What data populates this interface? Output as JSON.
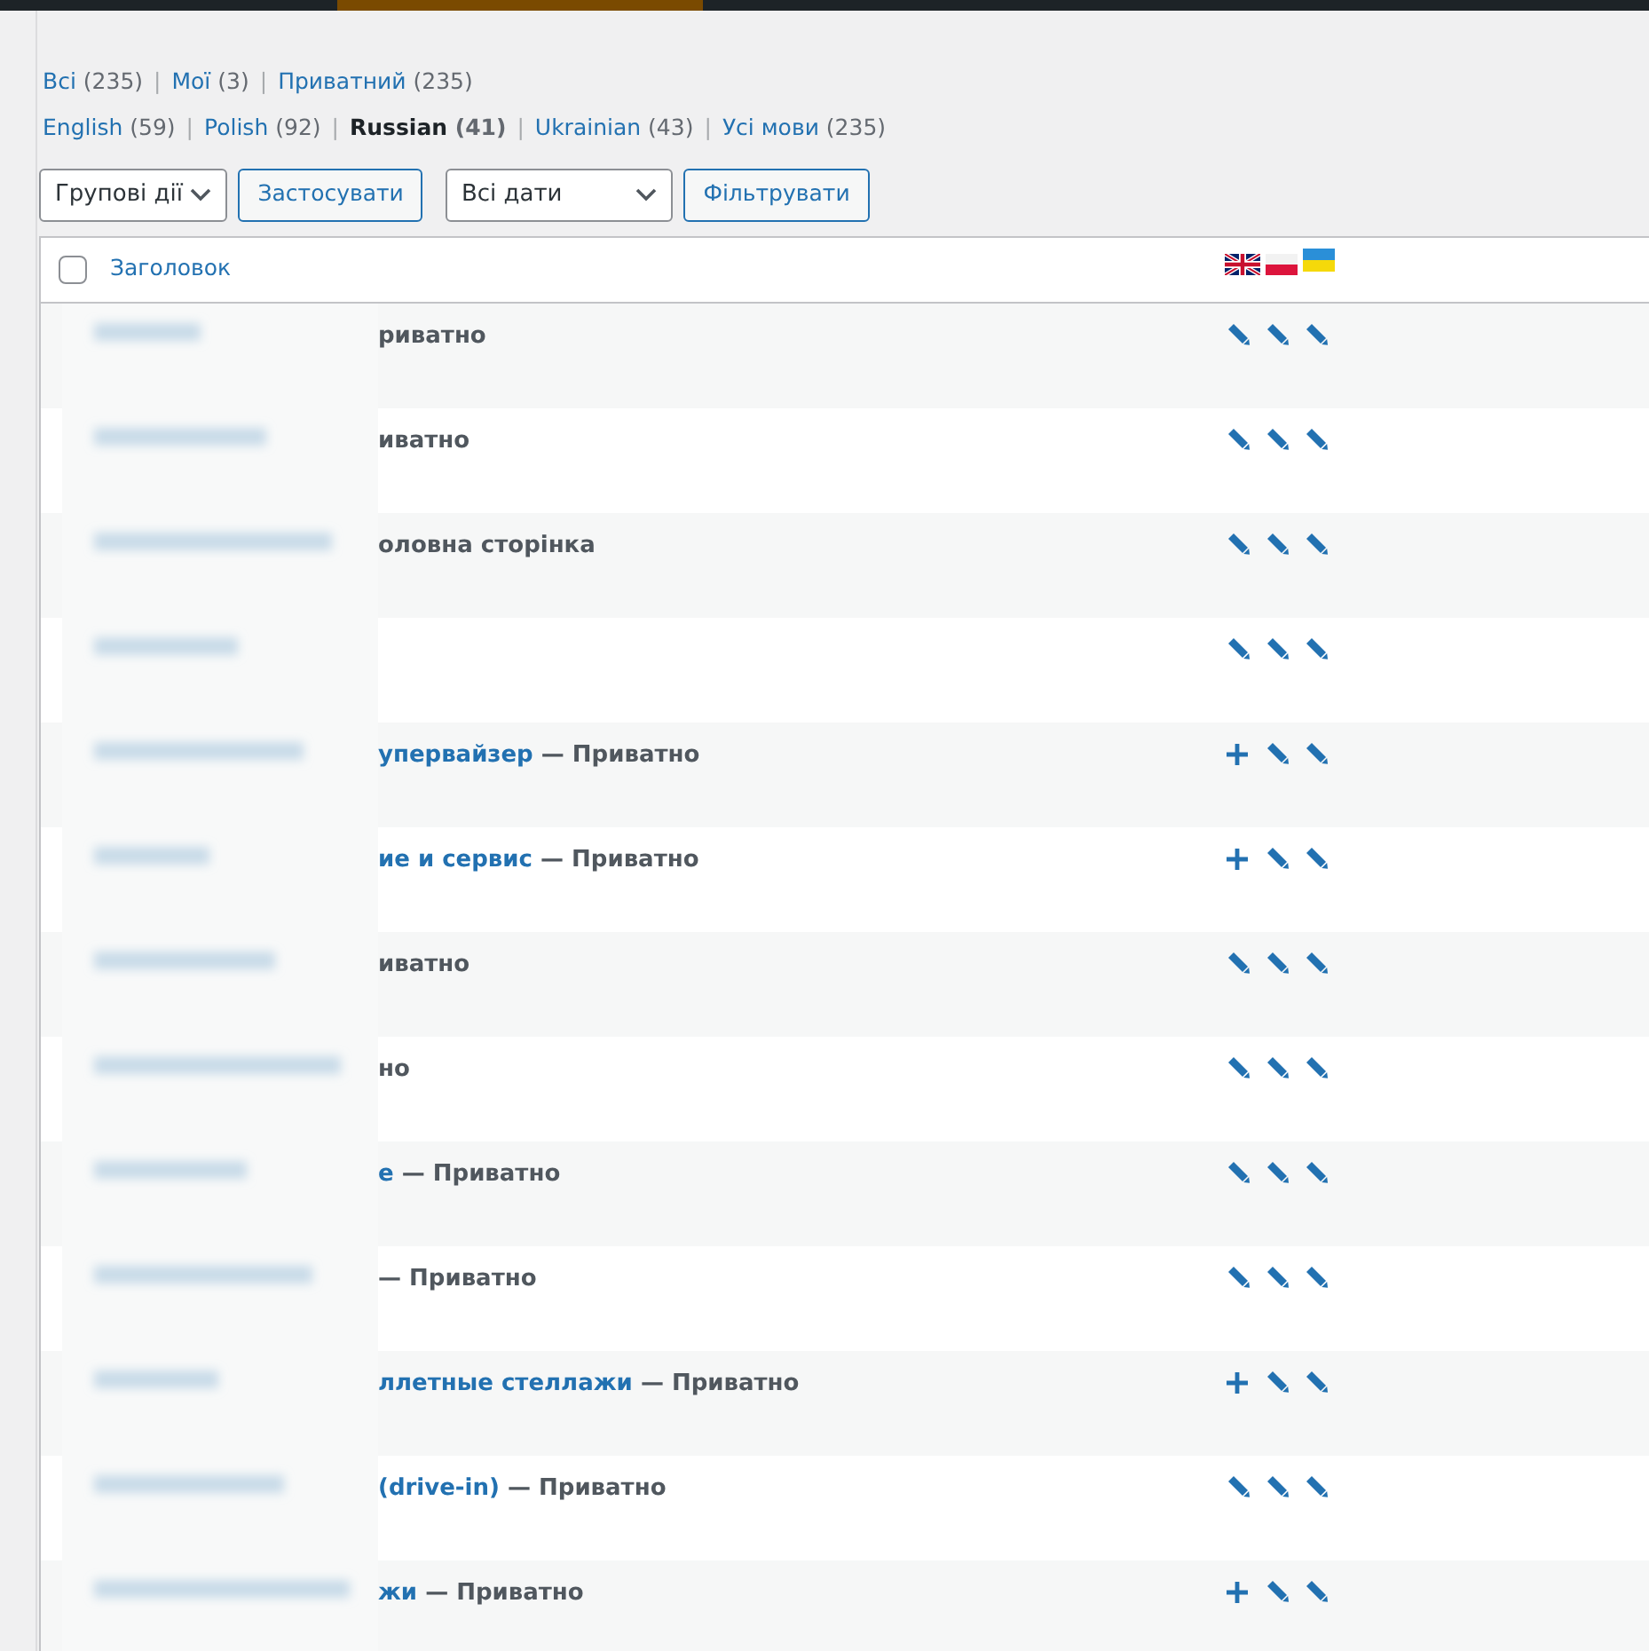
{
  "views": [
    {
      "label": "Всі",
      "count": "(235)",
      "selected": false,
      "separator": "|"
    },
    {
      "label": "Мої",
      "count": "(3)",
      "selected": false,
      "separator": "|"
    },
    {
      "label": "Приватний",
      "count": "(235)",
      "selected": false
    }
  ],
  "languages": [
    {
      "label": "English",
      "count": "(59)",
      "selected": false,
      "separator": "|"
    },
    {
      "label": "Polish",
      "count": "(92)",
      "selected": false,
      "separator": "|"
    },
    {
      "label": "Russian",
      "count": "(41)",
      "selected": true,
      "separator": "|"
    },
    {
      "label": "Ukrainian",
      "count": "(43)",
      "selected": false,
      "separator": "|"
    },
    {
      "label": "Усі мови",
      "count": "(235)",
      "selected": false
    }
  ],
  "bulk_actions": {
    "value": "Групові дії"
  },
  "apply_button": "Застосувати",
  "date_filter": {
    "value": "Всі дати"
  },
  "filter_button": "Фільтрувати",
  "table": {
    "select_all": {
      "checked": false
    },
    "columns": [
      {
        "label": "Заголовок"
      }
    ],
    "rows": [
      {
        "state": "риватно",
        "translations": [
          {
            "kind": "edit"
          },
          {
            "kind": "edit"
          },
          {
            "kind": "edit"
          }
        ]
      },
      {
        "state": "иватно",
        "translations": [
          {
            "kind": "edit"
          },
          {
            "kind": "edit"
          },
          {
            "kind": "edit"
          }
        ]
      },
      {
        "state": "оловна сторінка",
        "translations": [
          {
            "kind": "edit"
          },
          {
            "kind": "edit"
          },
          {
            "kind": "edit"
          }
        ]
      },
      {
        "translations": [
          {
            "kind": "edit"
          },
          {
            "kind": "edit"
          },
          {
            "kind": "edit"
          }
        ]
      },
      {
        "title": "упервайзер",
        "state": "— Приватно",
        "translations": [
          {
            "kind": "add"
          },
          {
            "kind": "edit"
          },
          {
            "kind": "edit"
          }
        ]
      },
      {
        "title": "ие и сервис",
        "state": "— Приватно",
        "translations": [
          {
            "kind": "add"
          },
          {
            "kind": "edit"
          },
          {
            "kind": "edit"
          }
        ]
      },
      {
        "state": "иватно",
        "translations": [
          {
            "kind": "edit"
          },
          {
            "kind": "edit"
          },
          {
            "kind": "edit"
          }
        ]
      },
      {
        "state": "но",
        "translations": [
          {
            "kind": "edit"
          },
          {
            "kind": "edit"
          },
          {
            "kind": "edit"
          }
        ]
      },
      {
        "title": "е",
        "state": "— Приватно",
        "translations": [
          {
            "kind": "edit"
          },
          {
            "kind": "edit"
          },
          {
            "kind": "edit"
          }
        ]
      },
      {
        "state": "— Приватно",
        "translations": [
          {
            "kind": "edit"
          },
          {
            "kind": "edit"
          },
          {
            "kind": "edit"
          }
        ]
      },
      {
        "title": "ллетные стеллажи",
        "state": "— Приватно",
        "translations": [
          {
            "kind": "add"
          },
          {
            "kind": "edit"
          },
          {
            "kind": "edit"
          }
        ]
      },
      {
        "title": "(drive-in)",
        "state": "— Приватно",
        "translations": [
          {
            "kind": "edit"
          },
          {
            "kind": "edit"
          },
          {
            "kind": "edit"
          }
        ]
      },
      {
        "title": "жи",
        "state": "— Приватно",
        "translations": [
          {
            "kind": "add"
          },
          {
            "kind": "edit"
          },
          {
            "kind": "edit"
          }
        ]
      }
    ]
  }
}
